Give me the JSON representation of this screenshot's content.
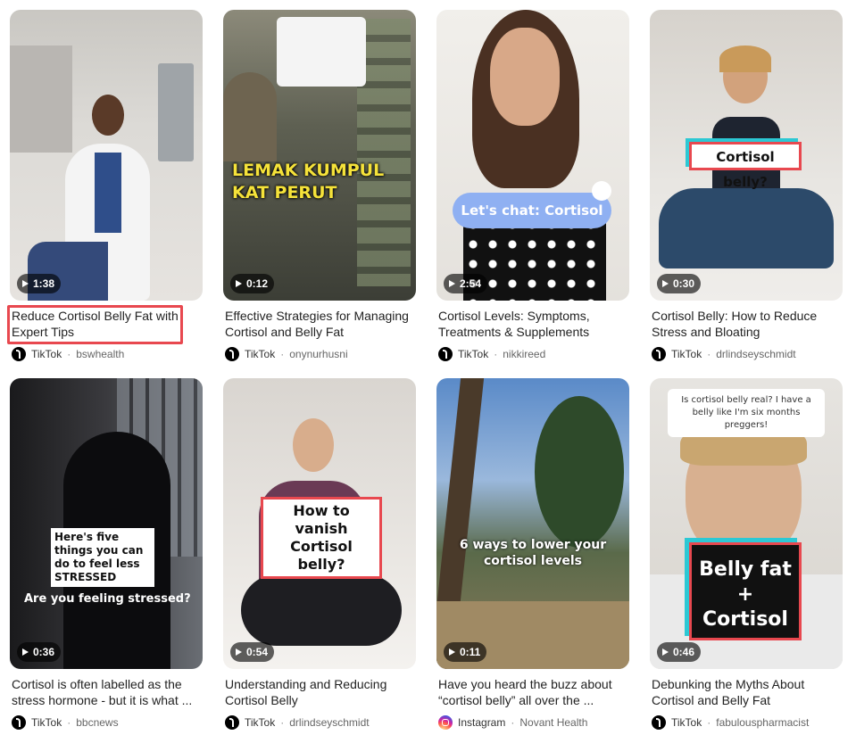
{
  "colors": {
    "highlight": "#e8484f",
    "tiktok": "#000000",
    "instagram": "#d6249f"
  },
  "cards": [
    {
      "duration": "1:38",
      "title": "Reduce Cortisol Belly Fat with Expert Tips",
      "platform": "TikTok",
      "channel": "bswhealth",
      "icon": "tiktok-icon",
      "selected": true,
      "overlay": ""
    },
    {
      "duration": "0:12",
      "title": "Effective Strategies for Managing Cortisol and Belly Fat",
      "platform": "TikTok",
      "channel": "onynurhusni",
      "icon": "tiktok-icon",
      "overlay": "LEMAK KUMPUL KAT PERUT"
    },
    {
      "duration": "2:54",
      "title": "Cortisol Levels: Symptoms, Treatments & Supplements",
      "platform": "TikTok",
      "channel": "nikkireed",
      "icon": "tiktok-icon",
      "overlay": "Let's chat: Cortisol"
    },
    {
      "duration": "0:30",
      "title": "Cortisol Belly: How to Reduce Stress and Bloating",
      "platform": "TikTok",
      "channel": "drlindseyschmidt",
      "icon": "tiktok-icon",
      "overlay": "Cortisol belly?"
    },
    {
      "duration": "0:36",
      "title": "Cortisol is often labelled as the stress hormone - but it is what ...",
      "platform": "TikTok",
      "channel": "bbcnews",
      "icon": "tiktok-icon",
      "overlay": "Here's five things you can do to feel less STRESSED",
      "overlay2": "Are you feeling stressed?"
    },
    {
      "duration": "0:54",
      "title": "Understanding and Reducing Cortisol Belly",
      "platform": "TikTok",
      "channel": "drlindseyschmidt",
      "icon": "tiktok-icon",
      "overlay": "How to vanish Cortisol belly?"
    },
    {
      "duration": "0:11",
      "title": "Have you heard the buzz about “cortisol belly” all over the ...",
      "platform": "Instagram",
      "channel": "Novant Health",
      "icon": "instagram-icon",
      "overlay": "6 ways to lower your cortisol levels"
    },
    {
      "duration": "0:46",
      "title": "Debunking the Myths About Cortisol and Belly Fat",
      "platform": "TikTok",
      "channel": "fabulouspharmacist",
      "icon": "tiktok-icon",
      "overlay": "Belly fat + Cortisol",
      "overlay2": "Is cortisol belly real? I have a belly like I'm six months preggers!"
    }
  ]
}
